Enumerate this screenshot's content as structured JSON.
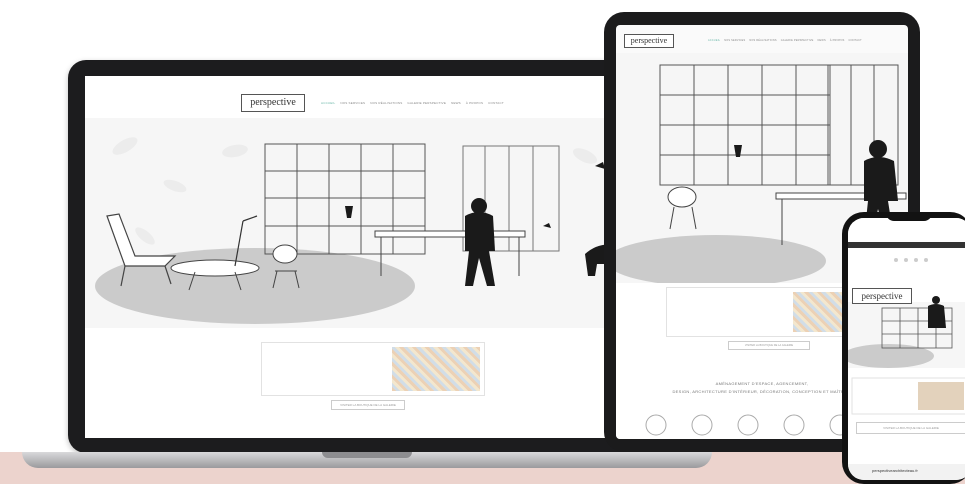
{
  "site": {
    "logo": "perspective",
    "nav": [
      "ACCUEIL",
      "NOS SERVICES",
      "NOS RÉALISATIONS",
      "GALERIE PERSPECTIVE",
      "NEWS",
      "À PROPOS",
      "CONTACT"
    ],
    "tagline_line1": "AMÉNAGEMENT D'ESPACE, AGENCEMENT,",
    "tagline_line2": "DESIGN, ARCHITECTURE D'INTÉRIEUR, DÉCORATION, CONCEPTION ET MAÎTRISE",
    "gallery_button": "VISITER LA BOUTIQUE DE LA GALERIE",
    "url": "perspectivearchitecteau.fr"
  },
  "colors": {
    "floor": "#ecd3cd",
    "device_frame": "#1c1c1e",
    "accent_nav": "#6ab7a8",
    "rug": "#cbcbcb"
  }
}
